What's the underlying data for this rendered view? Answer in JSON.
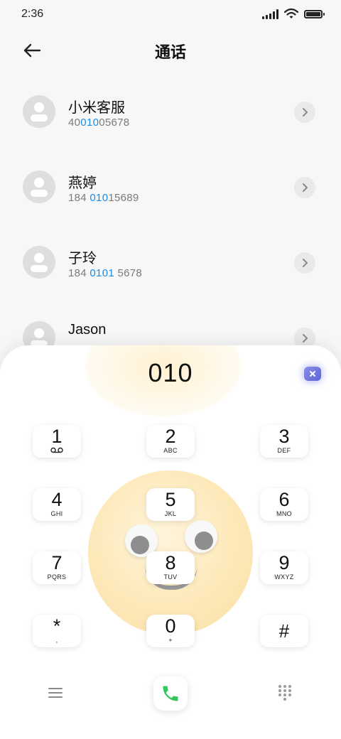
{
  "status_bar": {
    "time": "2:36",
    "icons": [
      "signal-icon",
      "wifi-icon",
      "battery-icon"
    ]
  },
  "header": {
    "title": "通话",
    "back_icon": "back-arrow-icon"
  },
  "contacts": [
    {
      "name": "小米客服",
      "number_parts": [
        {
          "t": "40",
          "h": false
        },
        {
          "t": "010",
          "h": true
        },
        {
          "t": "05678",
          "h": false
        }
      ]
    },
    {
      "name": "燕婷",
      "number_parts": [
        {
          "t": "184 ",
          "h": false
        },
        {
          "t": "010",
          "h": true
        },
        {
          "t": "15689",
          "h": false
        }
      ]
    },
    {
      "name": "子玲",
      "number_parts": [
        {
          "t": "184 ",
          "h": false
        },
        {
          "t": "0101",
          "h": true
        },
        {
          "t": " 5678",
          "h": false
        }
      ]
    },
    {
      "name": "Jason",
      "number_parts": []
    }
  ],
  "dialer": {
    "digits": "010",
    "keys": [
      {
        "digit": "1",
        "letters": "voicemail-icon"
      },
      {
        "digit": "2",
        "letters": "ABC"
      },
      {
        "digit": "3",
        "letters": "DEF"
      },
      {
        "digit": "4",
        "letters": "GHI"
      },
      {
        "digit": "5",
        "letters": "JKL"
      },
      {
        "digit": "6",
        "letters": "MNO"
      },
      {
        "digit": "7",
        "letters": "PQRS"
      },
      {
        "digit": "8",
        "letters": "TUV"
      },
      {
        "digit": "9",
        "letters": "WXYZ"
      },
      {
        "digit": "*",
        "letters": ","
      },
      {
        "digit": "0",
        "letters": "+"
      },
      {
        "digit": "#",
        "letters": ""
      }
    ]
  },
  "colors": {
    "highlight": "#1a8be6",
    "call_green": "#34c759",
    "delete_purple": "#6b70dc",
    "face_yellow": "#fde8b8"
  }
}
